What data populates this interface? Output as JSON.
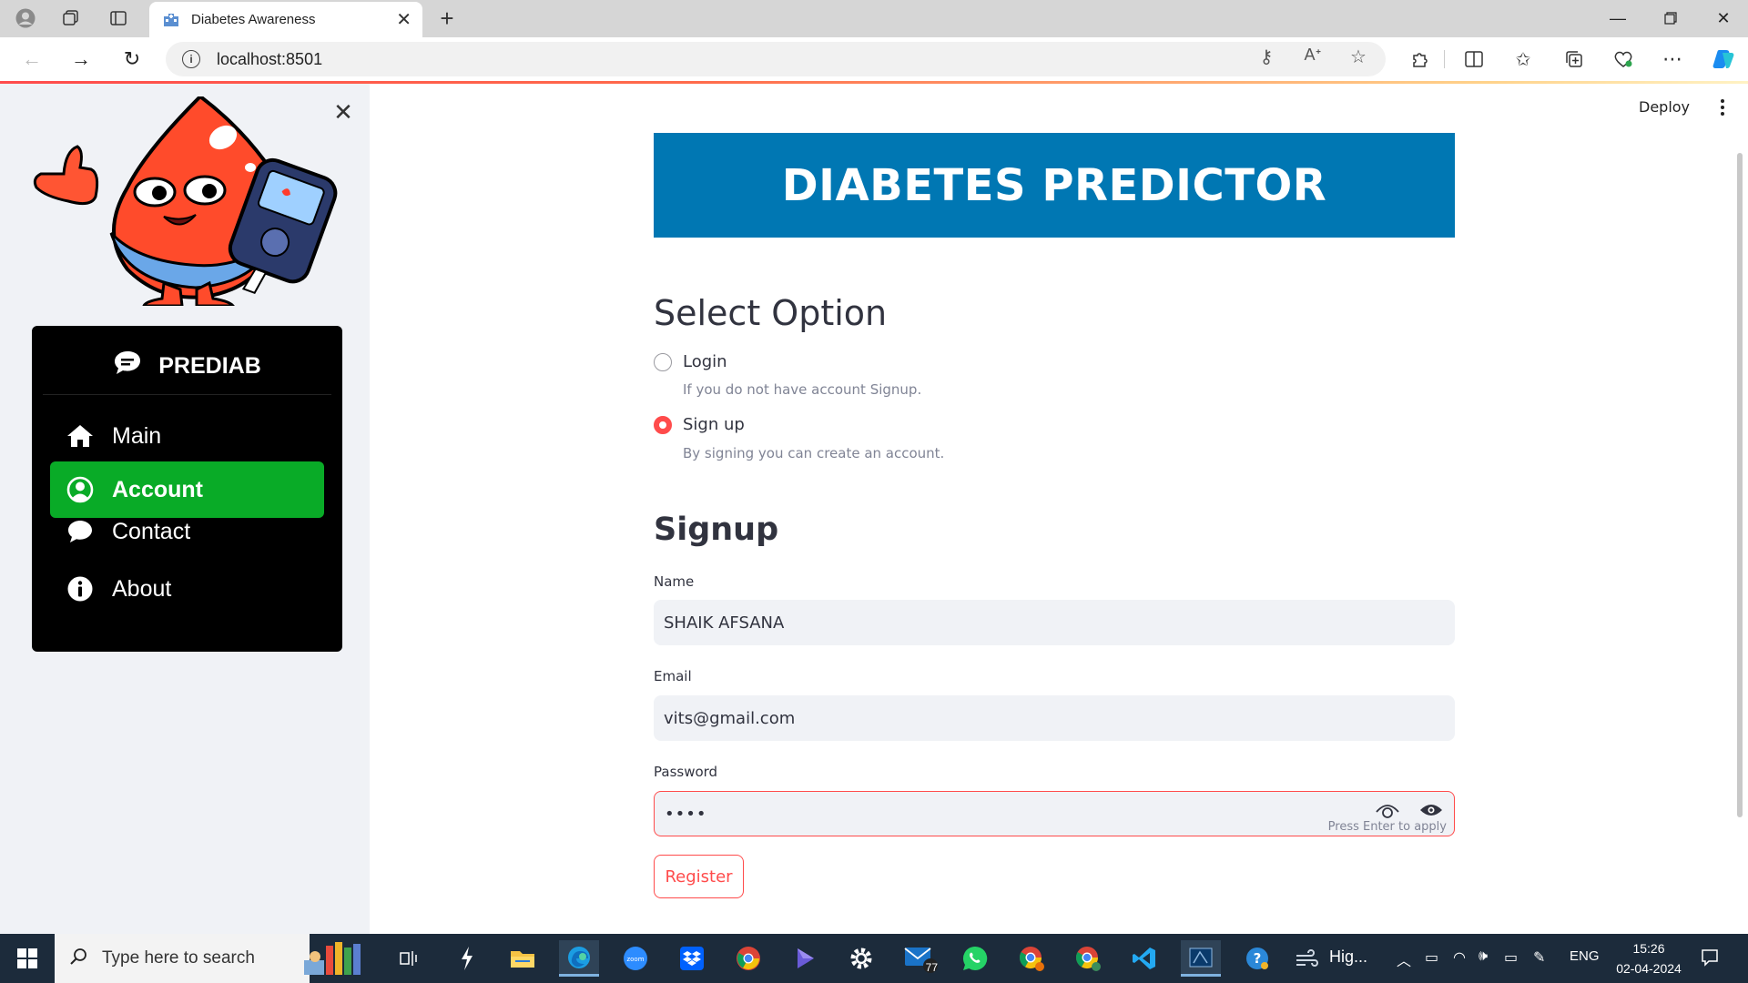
{
  "browser": {
    "tab_title": "Diabetes Awareness",
    "url": "localhost:8501",
    "colors": {
      "tabbar": "#d6d6d6",
      "accent_loading": "#ff4b4b"
    }
  },
  "app": {
    "header": {
      "deploy_label": "Deploy"
    },
    "sidebar": {
      "menu_title": "PREDIAB",
      "items": [
        {
          "label": "Main",
          "icon": "house-icon",
          "active": false
        },
        {
          "label": "Account",
          "icon": "person-circle-icon",
          "active": true
        },
        {
          "label": "Contact",
          "icon": "chat-icon",
          "active": false
        },
        {
          "label": "About",
          "icon": "info-circle-icon",
          "active": false
        }
      ],
      "colors": {
        "menu_bg": "#000000",
        "active_bg": "#09ab27"
      }
    },
    "banner": {
      "title": "DIABETES PREDICTOR",
      "bg": "#0077b3"
    },
    "select": {
      "title": "Select Option",
      "options": [
        {
          "label": "Login",
          "help": "If you do not have account Signup.",
          "selected": false
        },
        {
          "label": "Sign up",
          "help": "By signing you can create an account.",
          "selected": true
        }
      ]
    },
    "signup": {
      "title": "Signup",
      "name_label": "Name",
      "name_value": "SHAIK AFSANA",
      "email_label": "Email",
      "email_value": "vits@gmail.com",
      "password_label": "Password",
      "password_value": "••••",
      "password_hint": "Press Enter to apply",
      "register_label": "Register"
    }
  },
  "taskbar": {
    "search_placeholder": "Type here to search",
    "weather_text": "Hig...",
    "language": "ENG",
    "time": "15:26",
    "date": "02-04-2024",
    "mail_badge": "77"
  }
}
